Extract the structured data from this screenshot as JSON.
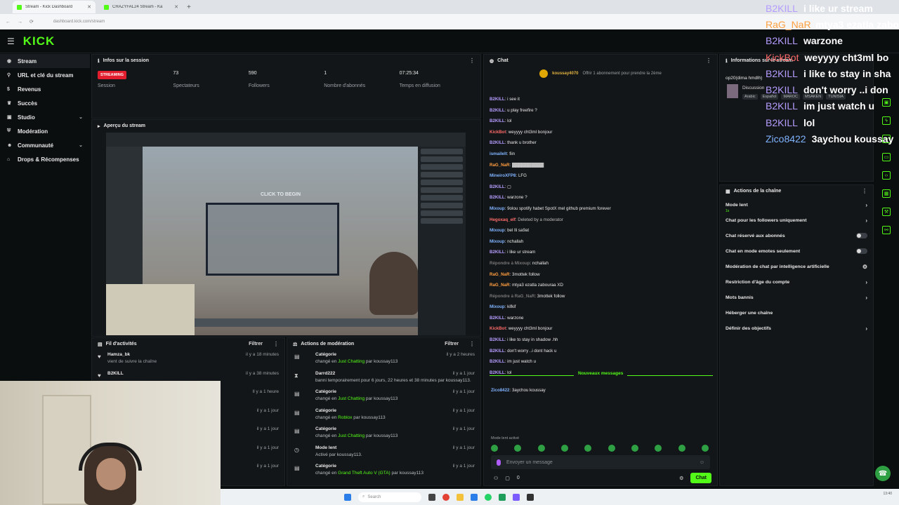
{
  "browser": {
    "tabs": [
      {
        "title": "Stream - Kick Dashboard"
      },
      {
        "title": "CRAZYFAL24 Stream - Ka"
      }
    ],
    "url": "dashboard.kick.com/stream"
  },
  "brand": {
    "logo": "KICK",
    "accent": "#53fc18"
  },
  "sidebar": {
    "items": [
      {
        "label": "Stream",
        "icon": "broadcast-icon"
      },
      {
        "label": "URL et clé du stream",
        "icon": "link-icon"
      },
      {
        "label": "Revenus",
        "icon": "dollar-icon"
      },
      {
        "label": "Succès",
        "icon": "trophy-icon"
      },
      {
        "label": "Studio",
        "icon": "studio-icon"
      },
      {
        "label": "Modération",
        "icon": "shield-icon"
      },
      {
        "label": "Communauté",
        "icon": "users-icon"
      },
      {
        "label": "Drops & Récompenses",
        "icon": "gift-icon"
      }
    ]
  },
  "session": {
    "title": "Infos sur la session",
    "badge": "STREAMING",
    "stats": [
      {
        "value": "",
        "label": "Session"
      },
      {
        "value": "73",
        "label": "Spectateurs"
      },
      {
        "value": "590",
        "label": "Followers"
      },
      {
        "value": "1",
        "label": "Nombre d'abonnés"
      },
      {
        "value": "07:25:34",
        "label": "Temps en diffusion"
      }
    ]
  },
  "preview": {
    "title": "Aperçu du stream",
    "click_text": "CLICK TO BEGIN"
  },
  "activity": {
    "title": "Fil d'activités",
    "filter": "Filtrer",
    "items": [
      {
        "name": "Hamza_bk",
        "sub": "vient de suivre la chaîne",
        "time": "il y a 18 minutes"
      },
      {
        "name": "B2KILL",
        "sub": "",
        "time": "il y a 38 minutes"
      },
      {
        "name": "",
        "sub": "",
        "time": "Il y a 1 heure"
      },
      {
        "name": "",
        "sub": "",
        "time": "il y a 1 jour"
      },
      {
        "name": "",
        "sub": "",
        "time": "il y a 1 jour"
      },
      {
        "name": "",
        "sub": "",
        "time": "il y a 1 jour"
      },
      {
        "name": "",
        "sub": "",
        "time": "il y a 1 jour"
      }
    ]
  },
  "moderation": {
    "title": "Actions de modération",
    "filter": "Filtrer",
    "items": [
      {
        "icon": "calendar-icon",
        "title": "Catégorie",
        "pre": "changé en ",
        "hl": "Just Chatting",
        "post": " par koussay113",
        "time": "il y a 2 heures"
      },
      {
        "icon": "hourglass-icon",
        "title": "Darrd222",
        "pre": "banni temporairement pour 6 jours, 22 heures et 38 minutes par koussay113.",
        "hl": "",
        "post": "",
        "time": "il y a 1 jour"
      },
      {
        "icon": "calendar-icon",
        "title": "Catégorie",
        "pre": "changé en ",
        "hl": "Just Chatting",
        "post": " par koussay113",
        "time": "il y a 1 jour"
      },
      {
        "icon": "calendar-icon",
        "title": "Catégorie",
        "pre": "changé en ",
        "hl": "Roblox",
        "post": " par koussay113",
        "time": "il y a 1 jour"
      },
      {
        "icon": "calendar-icon",
        "title": "Catégorie",
        "pre": "changé en ",
        "hl": "Just Chatting",
        "post": " par koussay113",
        "time": "il y a 1 jour"
      },
      {
        "icon": "clock-icon",
        "title": "Mode lent",
        "pre": "Activé par ",
        "hl": "",
        "post": "koussay113.",
        "time": "il y a 1 jour"
      },
      {
        "icon": "calendar-icon",
        "title": "Catégorie",
        "pre": "changé en ",
        "hl": "Grand Theft Auto V (GTA)",
        "post": " par koussay113",
        "time": "il y a 1 jour"
      }
    ]
  },
  "chat": {
    "title": "Chat",
    "gift_user": "koussay4070",
    "gift_text": "Offrir 1 abonnement pour prendre la 2ème",
    "messages": [
      {
        "name": "B2KILL",
        "color": "#b59cff",
        "text": "i see it"
      },
      {
        "name": "B2KILL",
        "color": "#b59cff",
        "text": "u play freefire ?"
      },
      {
        "name": "B2KILL",
        "color": "#b59cff",
        "text": "lol"
      },
      {
        "name": "KickBot",
        "color": "#ff6b6b",
        "text": "weyyyy cht3ml bonjour"
      },
      {
        "name": "B2KILL",
        "color": "#b59cff",
        "text": "thank u brother"
      },
      {
        "name": "ismailelt",
        "color": "#7fb3ff",
        "text": "fiin"
      },
      {
        "name": "RaG_NaR",
        "color": "#ff9f40",
        "text": "▓▓▓▓▓▓▓▓▓▓"
      },
      {
        "name": "MineiroXFP8",
        "color": "#7fb3ff",
        "text": "LFG"
      },
      {
        "name": "B2KILL",
        "color": "#b59cff",
        "text": "▢"
      },
      {
        "name": "B2KILL",
        "color": "#b59cff",
        "text": "warzone ?"
      },
      {
        "name": "Mixoup",
        "color": "#7fb3ff",
        "text": "9olou spotify habet SpotX mel github premium forever"
      },
      {
        "name": "Hegoxaq_elf",
        "color": "#ff6b6b",
        "text": "Deleted by a moderator"
      },
      {
        "name": "Mixoup",
        "color": "#7fb3ff",
        "text": "bel lli sa9at"
      },
      {
        "name": "Mixoup",
        "color": "#7fb3ff",
        "text": "nchallah"
      },
      {
        "name": "B2KILL",
        "color": "#b59cff",
        "text": "i like ur stream"
      },
      {
        "name": "Répondre à Mixoup",
        "color": "#777777",
        "text": "nchallah"
      },
      {
        "name": "RaG_NaR",
        "color": "#ff9f40",
        "text": "3mottek follow"
      },
      {
        "name": "RaG_NaR",
        "color": "#ff9f40",
        "text": "mtya3 ezatla zabouraa XD"
      },
      {
        "name": "Répondre à RaG_NaR",
        "color": "#777777",
        "text": "3mottek follow"
      },
      {
        "name": "Mixoup",
        "color": "#7fb3ff",
        "text": "kifkif"
      },
      {
        "name": "B2KILL",
        "color": "#b59cff",
        "text": "warzone"
      },
      {
        "name": "KickBot",
        "color": "#ff6b6b",
        "text": "weyyyy cht3ml bonjour"
      },
      {
        "name": "B2KILL",
        "color": "#b59cff",
        "text": "i like to stay in shadow .hh"
      },
      {
        "name": "B2KILL",
        "color": "#b59cff",
        "text": "don't worry ..i dont hack u"
      },
      {
        "name": "B2KILL",
        "color": "#b59cff",
        "text": "im just watch u"
      },
      {
        "name": "B2KILL",
        "color": "#b59cff",
        "text": "lol"
      }
    ],
    "new_label": "Nouveaux messages",
    "last": {
      "name": "Zico8422",
      "color": "#7fb3ff",
      "text": "3aychou koussay"
    },
    "slow_mode": "Mode lent activé",
    "input_placeholder": "Envoyer un message",
    "count": "0",
    "send": "Chat"
  },
  "stream_info": {
    "title": "Informations sur le stream",
    "category": "op20(dima hmdlh)",
    "discussion": "Discussion",
    "tags": [
      "Arabic",
      "Español",
      "MAROC",
      "MSAKEN",
      "TUNISIA"
    ]
  },
  "channel_actions": {
    "title": "Actions de la chaîne",
    "items": [
      {
        "label": "Mode lent",
        "sub": "1s",
        "control": "chevron"
      },
      {
        "label": "Chat pour les followers uniquement",
        "sub": "",
        "control": "chevron"
      },
      {
        "label": "Chat réservé aux abonnés",
        "sub": "",
        "control": "toggle"
      },
      {
        "label": "Chat en mode emotes seulement",
        "sub": "",
        "control": "toggle"
      },
      {
        "label": "Modération de chat par intelligence artificielle",
        "sub": "",
        "control": "icon"
      },
      {
        "label": "Restriction d'âge du compte",
        "sub": "",
        "control": "chevron"
      },
      {
        "label": "Mots bannis",
        "sub": "",
        "control": "chevron"
      },
      {
        "label": "Héberger une chaîne",
        "sub": "",
        "control": "none"
      },
      {
        "label": "Définir des objectifs",
        "sub": "",
        "control": "chevron"
      }
    ]
  },
  "overlay_chat": [
    {
      "name": "B2KILL",
      "color": "#b59cff",
      "text": "i like ur stream"
    },
    {
      "name": "RaG_NaR",
      "color": "#ff9f40",
      "text": "mtya3 ezatla zabo"
    },
    {
      "name": "B2KILL",
      "color": "#b59cff",
      "text": "warzone"
    },
    {
      "name": "KickBot",
      "color": "#ff6b6b",
      "text": "weyyyy cht3ml bo"
    },
    {
      "name": "B2KILL",
      "color": "#b59cff",
      "text": "i like to stay in sha"
    },
    {
      "name": "B2KILL",
      "color": "#b59cff",
      "text": "don't worry ..i don"
    },
    {
      "name": "B2KILL",
      "color": "#b59cff",
      "text": "im just watch u"
    },
    {
      "name": "B2KILL",
      "color": "#b59cff",
      "text": "lol"
    },
    {
      "name": "Zico8422",
      "color": "#7fb3ff",
      "text": "3aychou koussay"
    }
  ],
  "taskbar": {
    "search": "Search",
    "clock": "13:40"
  }
}
